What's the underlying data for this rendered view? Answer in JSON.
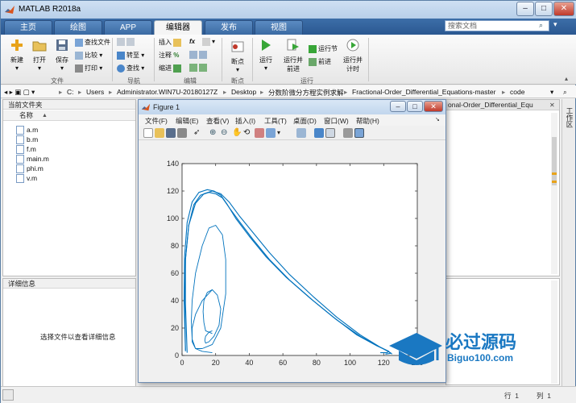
{
  "window": {
    "title": "MATLAB R2018a"
  },
  "tabs": [
    {
      "label": "主页"
    },
    {
      "label": "绘图"
    },
    {
      "label": "APP"
    },
    {
      "label": "编辑器"
    },
    {
      "label": "发布"
    },
    {
      "label": "视图"
    }
  ],
  "search": {
    "placeholder": "搜索文档"
  },
  "ribbon": {
    "file": {
      "new": "新建",
      "open": "打开",
      "save": "保存",
      "find_files": "查找文件",
      "compare": "比较",
      "print": "打印",
      "group": "文件"
    },
    "nav": {
      "goto": "转至",
      "find": "查找",
      "group": "导航"
    },
    "edit": {
      "insert": "插入",
      "comment": "注释",
      "indent": "缩进",
      "fx": "fx",
      "percent": "%",
      "group": "编辑"
    },
    "breakpoints": {
      "label": "断点",
      "group": "断点"
    },
    "run": {
      "run": "运行",
      "run_advance_l1": "运行并",
      "run_advance_l2": "前进",
      "run_section": "运行节",
      "advance": "前进",
      "run_time_l1": "运行并",
      "run_time_l2": "计时",
      "group": "运行"
    }
  },
  "address": {
    "parts": [
      "C:",
      "Users",
      "Administrator.WIN7U-20180127Z",
      "Desktop",
      "分数阶微分方程实例求解",
      "Fractional-Order_Differential_Equations-master",
      "code"
    ]
  },
  "file_panel": {
    "title": "当前文件夹",
    "col_name": "名称",
    "sort_indicator": "▲",
    "files": [
      {
        "name": "a.m"
      },
      {
        "name": "b.m"
      },
      {
        "name": "f.m"
      },
      {
        "name": "main.m"
      },
      {
        "name": "phi.m"
      },
      {
        "name": "v.m"
      }
    ]
  },
  "detail_panel": {
    "title": "详细信息",
    "message": "选择文件以查看详细信息"
  },
  "right_panel": {
    "title": "onal-Order_Differential_Equ"
  },
  "workspace_side": {
    "label": "工作区"
  },
  "statusbar": {
    "row_label": "行",
    "row": "1",
    "col_label": "列",
    "col": "1"
  },
  "figure": {
    "title": "Figure 1",
    "menu": [
      "文件(F)",
      "编辑(E)",
      "查看(V)",
      "插入(I)",
      "工具(T)",
      "桌面(D)",
      "窗口(W)",
      "帮助(H)"
    ]
  },
  "colors": {
    "line": "#0072bd",
    "accent": "#2b5891"
  },
  "watermark": {
    "brand": "必过源码",
    "url": "Biguo100.com"
  },
  "chart_data": {
    "type": "line",
    "title": "",
    "xlabel": "",
    "ylabel": "",
    "xlim": [
      0,
      140
    ],
    "ylim": [
      0,
      140
    ],
    "xticks": [
      0,
      20,
      40,
      60,
      80,
      100,
      120,
      140
    ],
    "yticks": [
      0,
      20,
      40,
      60,
      80,
      100,
      120,
      140
    ],
    "grid": false,
    "series": [
      {
        "x": [
          18,
          14,
          13,
          12.5,
          13,
          15,
          18,
          21,
          23,
          22,
          19,
          16,
          14,
          13.5,
          14,
          16,
          18
        ],
        "y": [
          16,
          18,
          24,
          32,
          40,
          46,
          48,
          44,
          34,
          22,
          14,
          10,
          9,
          11,
          14,
          17,
          18
        ]
      },
      {
        "x": [
          18,
          12,
          8,
          6,
          5.5,
          6,
          8,
          12,
          16,
          20,
          24,
          26,
          26,
          23,
          18,
          12,
          8,
          6,
          6,
          8,
          12,
          18
        ],
        "y": [
          2,
          3,
          5,
          12,
          25,
          40,
          60,
          80,
          93,
          95,
          88,
          70,
          45,
          20,
          8,
          5,
          5,
          10,
          20,
          30,
          40,
          48
        ]
      },
      {
        "x": [
          2,
          1.5,
          2,
          4,
          7,
          11,
          16,
          20,
          24,
          28,
          34,
          42,
          52,
          64,
          78,
          92,
          106,
          118,
          123,
          122,
          118
        ],
        "y": [
          4,
          40,
          70,
          95,
          110,
          117,
          119,
          118,
          115,
          108,
          98,
          85,
          70,
          55,
          40,
          26,
          14,
          6,
          3,
          2,
          2
        ]
      },
      {
        "x": [
          2,
          1.2,
          1.5,
          3,
          6,
          10,
          15,
          19,
          23,
          27,
          32,
          40,
          50,
          62,
          76,
          90,
          104,
          116,
          123,
          124,
          121
        ],
        "y": [
          3,
          40,
          72,
          97,
          112,
          119,
          121,
          120,
          117,
          110,
          100,
          87,
          72,
          57,
          42,
          28,
          15,
          7,
          3,
          1.5,
          1
        ]
      },
      {
        "x": [
          3,
          2,
          2,
          4,
          8,
          13,
          18,
          23,
          28,
          34,
          42,
          52,
          64,
          78,
          92,
          106,
          118,
          124,
          125
        ],
        "y": [
          2,
          38,
          70,
          95,
          111,
          118,
          120,
          118,
          112,
          102,
          90,
          75,
          59,
          43,
          28,
          15,
          6,
          2,
          1
        ]
      }
    ]
  }
}
